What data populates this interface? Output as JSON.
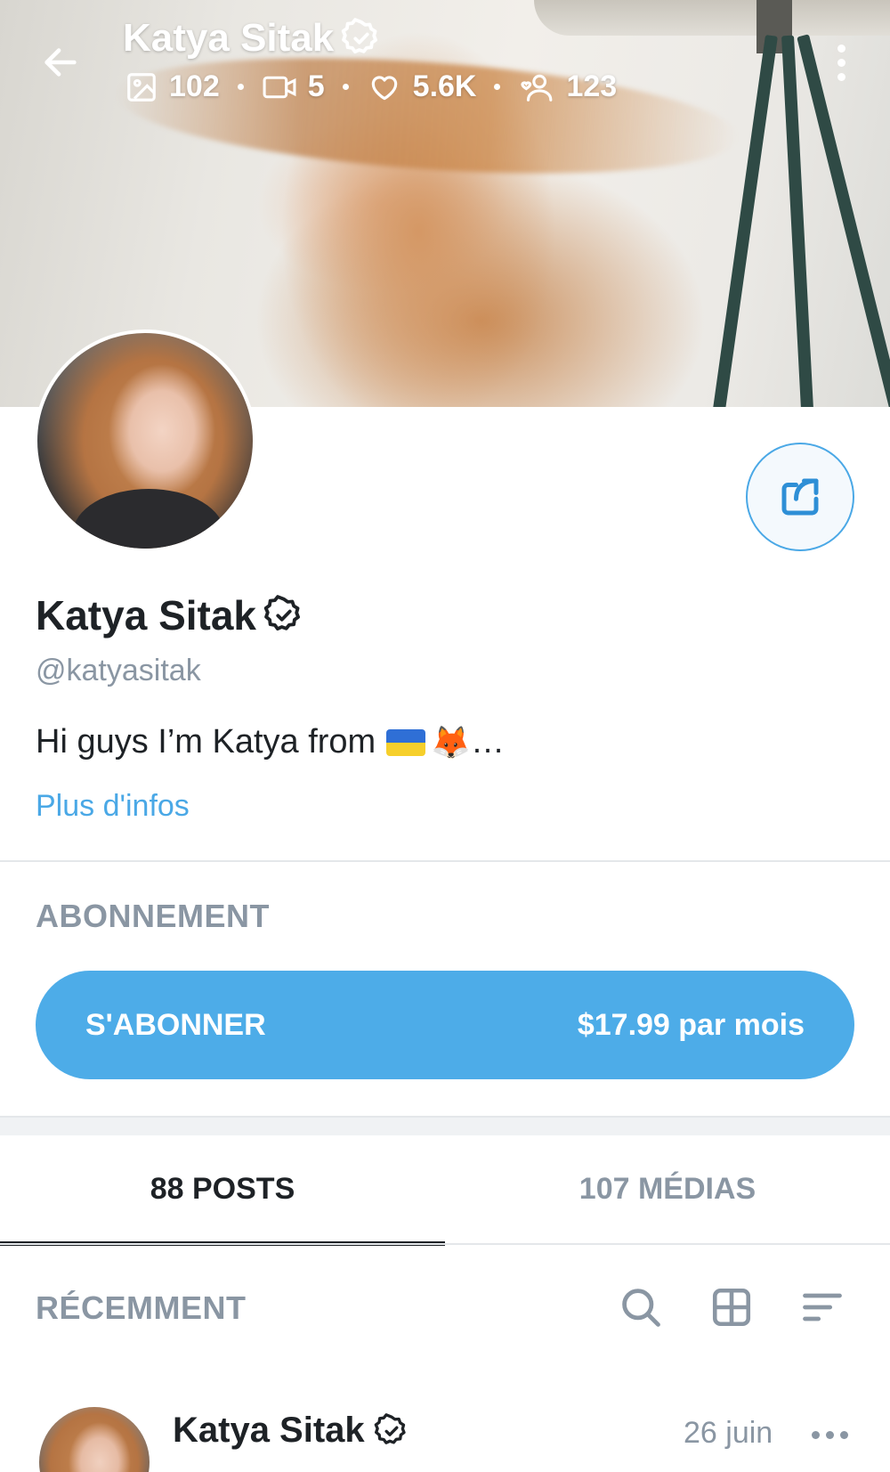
{
  "header": {
    "name": "Katya Sitak",
    "stats": {
      "photos": "102",
      "videos": "5",
      "likes": "5.6K",
      "fans": "123"
    }
  },
  "profile": {
    "name": "Katya Sitak",
    "handle": "@katyasitak",
    "bio": "Hi guys I’m Katya from",
    "bio_suffix": "…",
    "more_info": "Plus d'infos"
  },
  "subscription": {
    "section_title": "ABONNEMENT",
    "button_label": "S'ABONNER",
    "price": "$17.99 par mois"
  },
  "tabs": [
    {
      "label": "88 POSTS",
      "active": true
    },
    {
      "label": "107 MÉDIAS",
      "active": false
    }
  ],
  "feed": {
    "section_title": "RÉCEMMENT",
    "post": {
      "author": "Katya Sitak",
      "date": "26 juin"
    }
  },
  "icons": {
    "back": "arrow-left-icon",
    "verified": "verified-badge-icon",
    "photos": "image-icon",
    "videos": "video-icon",
    "likes": "heart-icon",
    "fans": "user-icon",
    "more": "more-vertical-icon",
    "share": "share-icon",
    "search": "search-icon",
    "grid": "grid-icon",
    "sort": "sort-icon",
    "post_more": "more-horizontal-icon"
  },
  "colors": {
    "accent": "#4dace8",
    "link": "#4aa8e6",
    "muted": "#8a96a3",
    "text": "#1e2226"
  }
}
